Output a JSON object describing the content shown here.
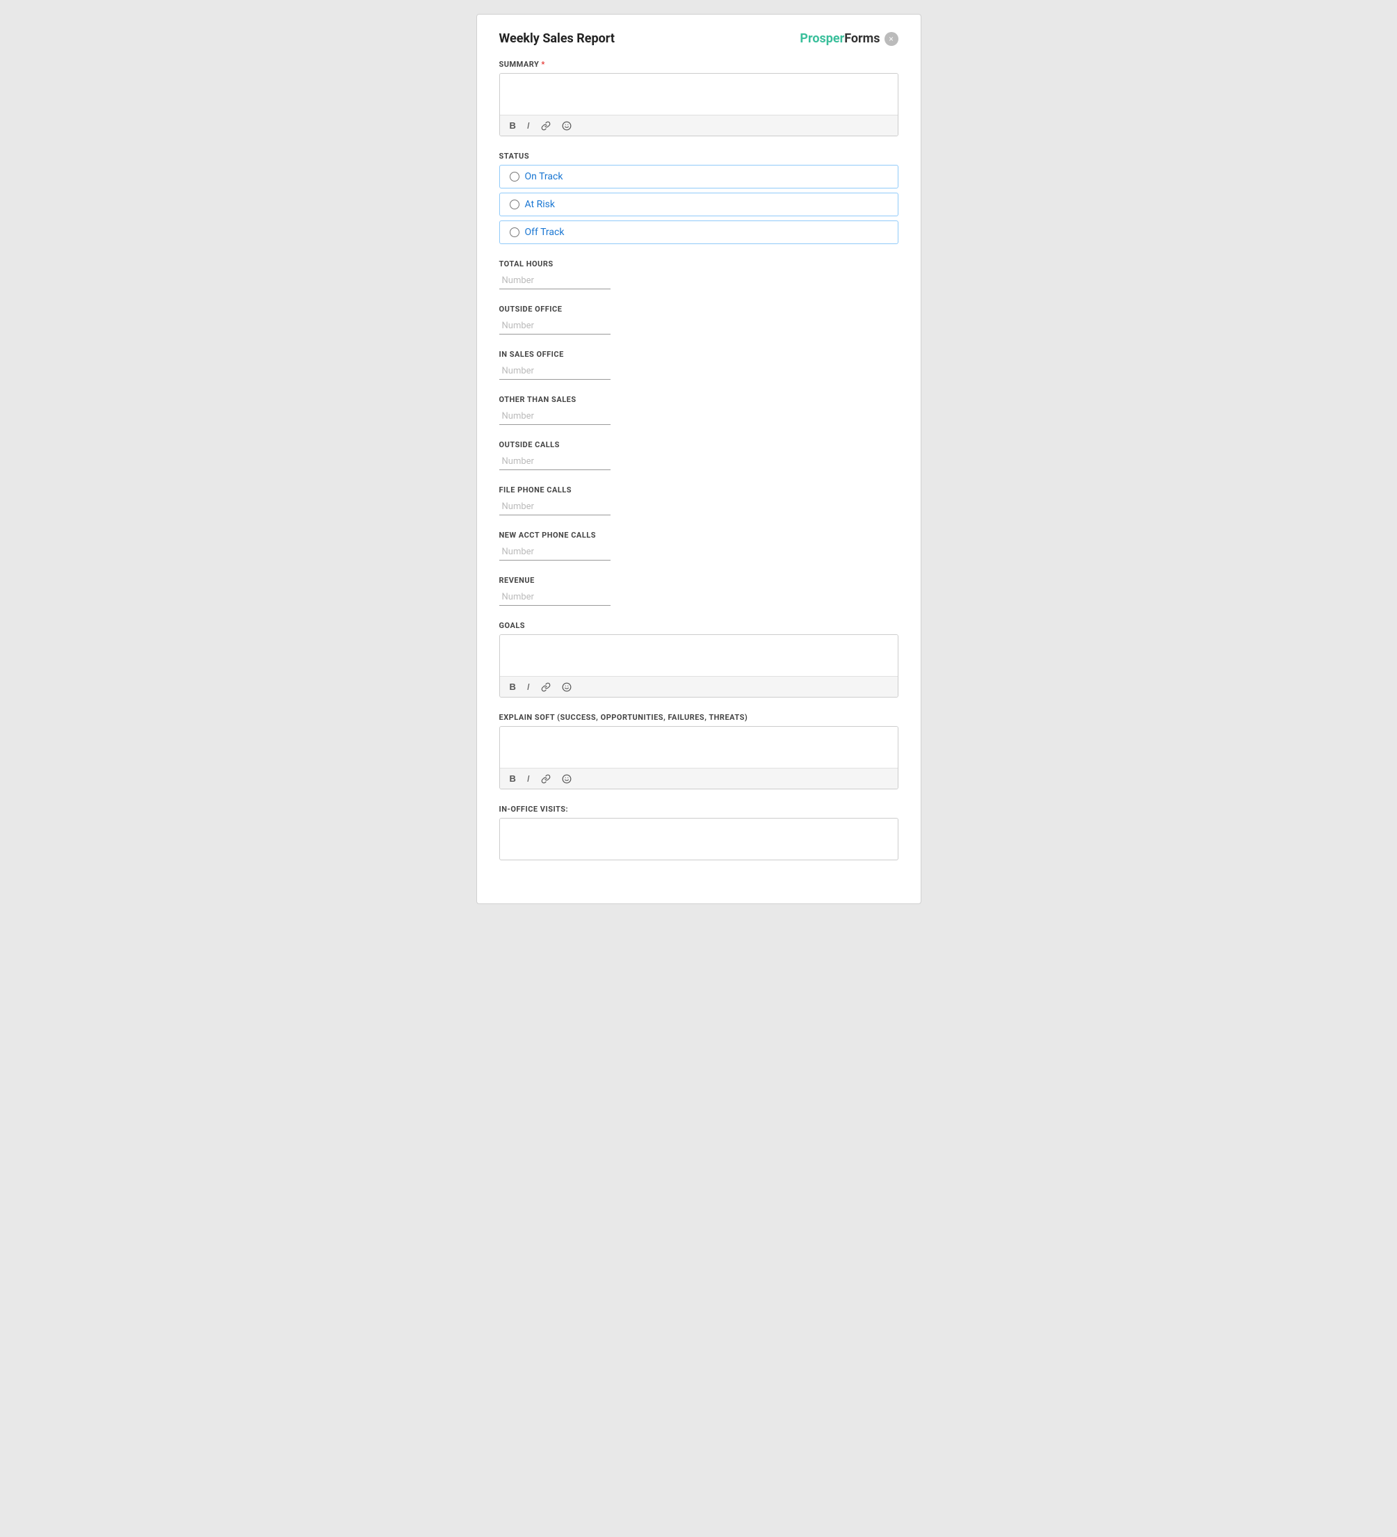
{
  "form": {
    "title": "Weekly Sales Report",
    "close_label": "×",
    "brand": {
      "prosper": "Prosper",
      "forms": "Forms"
    },
    "sections": {
      "summary": {
        "label": "SUMMARY",
        "required": true,
        "placeholder": ""
      },
      "status": {
        "label": "STATUS",
        "options": [
          {
            "id": "on-track",
            "label": "On Track",
            "checked": false
          },
          {
            "id": "at-risk",
            "label": "At Risk",
            "checked": false
          },
          {
            "id": "off-track",
            "label": "Off Track",
            "checked": false
          }
        ]
      },
      "total_hours": {
        "label": "TOTAL HOURS",
        "placeholder": "Number"
      },
      "outside_office": {
        "label": "OUTSIDE OFFICE",
        "placeholder": "Number"
      },
      "in_sales_office": {
        "label": "IN SALES OFFICE",
        "placeholder": "Number"
      },
      "other_than_sales": {
        "label": "OTHER THAN SALES",
        "placeholder": "Number"
      },
      "outside_calls": {
        "label": "OUTSIDE CALLS",
        "placeholder": "Number"
      },
      "file_phone_calls": {
        "label": "FILE PHONE CALLS",
        "placeholder": "Number"
      },
      "new_acct_phone_calls": {
        "label": "NEW ACCT PHONE CALLS",
        "placeholder": "Number"
      },
      "revenue": {
        "label": "REVENUE",
        "placeholder": "Number"
      },
      "goals": {
        "label": "GOALS",
        "placeholder": ""
      },
      "explain_soft": {
        "label": "EXPLAIN SOFT (SUCCESS, OPPORTUNITIES, FAILURES, THREATS)",
        "placeholder": ""
      },
      "in_office_visits": {
        "label": "IN-OFFICE VISITS:",
        "placeholder": ""
      }
    },
    "toolbar": {
      "bold_label": "B",
      "italic_label": "I",
      "link_symbol": "🔗",
      "emoji_symbol": "🙂"
    }
  }
}
